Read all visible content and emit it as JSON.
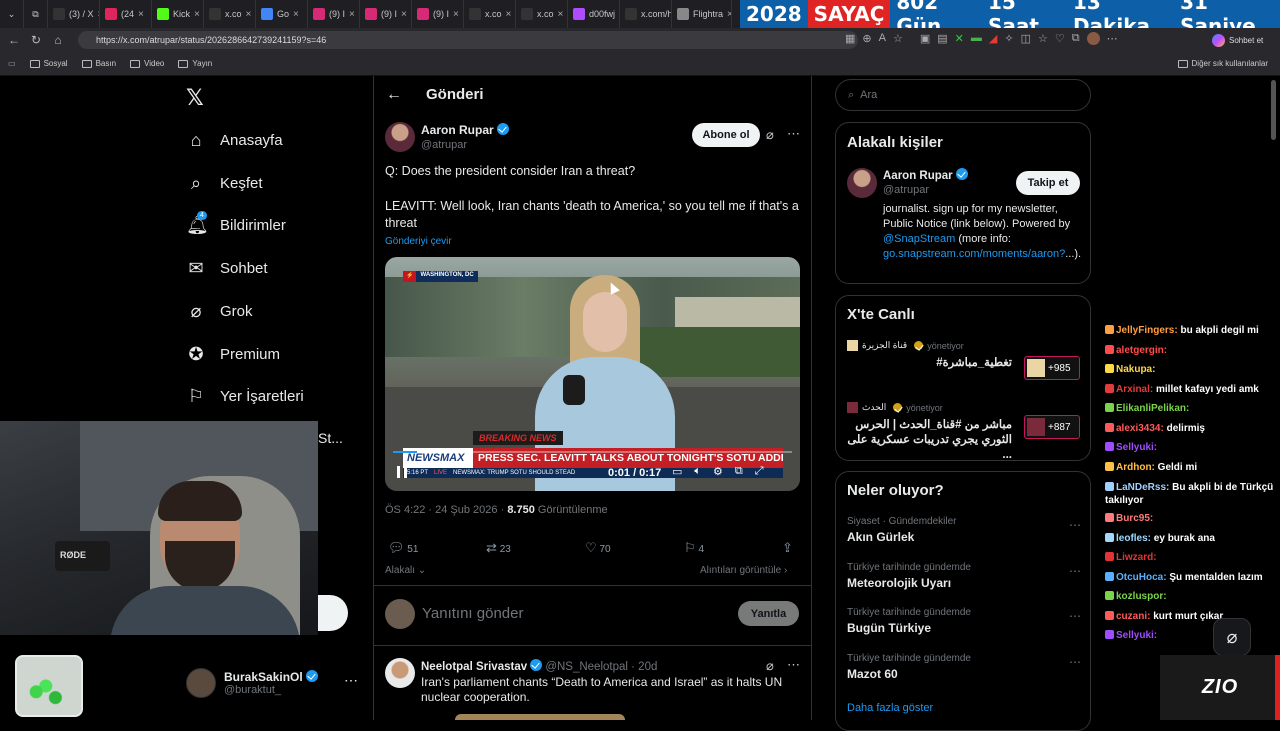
{
  "browser": {
    "tabs": [
      {
        "label": "(3) / X",
        "color": "#333"
      },
      {
        "label": "(24",
        "color": "#e0245e"
      },
      {
        "label": "Kick",
        "color": "#53fc18"
      },
      {
        "label": "x.co",
        "color": "#333"
      },
      {
        "label": "Go",
        "color": "#4285f4"
      },
      {
        "label": "(9) I",
        "color": "#d62976"
      },
      {
        "label": "(9) I",
        "color": "#d62976"
      },
      {
        "label": "(9) I",
        "color": "#d62976"
      },
      {
        "label": "x.co",
        "color": "#333"
      },
      {
        "label": "x.co",
        "color": "#333"
      },
      {
        "label": "d00fwj",
        "color": "#b04cff"
      },
      {
        "label": "x.com/h",
        "color": "#333"
      },
      {
        "label": "Flightra",
        "color": "#888"
      }
    ],
    "url": "https://x.com/atrupar/status/2026286642739241159?s=46",
    "chat_button": "Sohbet et",
    "bookmarks": [
      "Sosyal",
      "Basın",
      "Video",
      "Yayın"
    ],
    "other_bookmarks": "Diğer sık kullanılanlar"
  },
  "counter": {
    "year": "2028",
    "label": "SAYAÇ",
    "days": "802 Gün",
    "hours": "15 Saat",
    "minutes": "13 Dakika",
    "seconds": "31 Saniye"
  },
  "nav": {
    "items": [
      "Anasayfa",
      "Keşfet",
      "Bildirimler",
      "Sohbet",
      "Grok",
      "Premium",
      "Yer İşaretleri"
    ],
    "notif_count": "4",
    "partial_item": "St...",
    "user_name": "BurakSakinOl",
    "user_handle": "@buraktut_"
  },
  "post": {
    "header": "Gönderi",
    "author": "Aaron Rupar",
    "handle": "@atrupar",
    "subscribe": "Abone ol",
    "line1": "Q: Does the president consider Iran a threat?",
    "line2": "LEAVITT: Well look, Iran chants 'death to America,' so you tell me if that's a threat",
    "translate": "Gönderiyi çevir",
    "video": {
      "location": "WASHINGTON, DC",
      "breaking": "BREAKING NEWS",
      "network": "NEWSMAX",
      "headline": "PRESS SEC. LEAVITT TALKS ABOUT TONIGHT'S SOTU ADDRESS",
      "ticker": "NEWSMAX: TRUMP SOTU SHOULD STEAD",
      "time_left": "5:16 PT",
      "live": "LIVE",
      "timecode": "0:01 / 0:17",
      "progress": 0.06
    },
    "meta_time": "ÖS 4:22 · 24 Şub 2026 ·",
    "views": "8.750",
    "views_label": "Görüntülenme",
    "replies": "51",
    "reposts": "23",
    "likes": "70",
    "bookmarks": "4",
    "relevant": "Alakalı",
    "quotes": "Alıntıları görüntüle",
    "reply_placeholder": "Yanıtını gönder",
    "reply_button": "Yanıtla"
  },
  "reply": {
    "author": "Neelotpal Srivastav",
    "handle": "@NS_Neelotpal",
    "age": "· 20d",
    "text": "Iran's parliament chants “Death to America and Israel” as it halts UN nuclear cooperation."
  },
  "right": {
    "search_placeholder": "Ara",
    "people_title": "Alakalı kişiler",
    "person_name": "Aaron Rupar",
    "person_handle": "@atrupar",
    "follow": "Takip et",
    "bio1": "journalist. sign up for my newsletter, Public Notice (link below). Powered by",
    "bio_link1": "@SnapStream",
    "bio2": " (more info: ",
    "bio_link2": "go.snapstream.com/moments/aaron?",
    "bio3": "...).",
    "live_title": "X'te Canlı",
    "live": [
      {
        "host": "قناة الجزيرة",
        "role": "yönetiyor",
        "title": "تغطية_مباشرة#",
        "count": "+985"
      },
      {
        "host": "الحدث",
        "role": "yönetiyor",
        "title": "مباشر من #قناة_الحدث | الحرس الثوري يجري تدريبات عسكرية على ...",
        "count": "+887"
      }
    ],
    "trends_title": "Neler oluyor?",
    "trends": [
      {
        "cat": "Siyaset · Gündemdekiler",
        "name": "Akın Gürlek"
      },
      {
        "cat": "Türkiye tarihinde gündemde",
        "name": "Meteorolojik Uyarı"
      },
      {
        "cat": "Türkiye tarihinde gündemde",
        "name": "Bugün Türkiye"
      },
      {
        "cat": "Türkiye tarihinde gündemde",
        "name": "Mazot 60"
      }
    ],
    "show_more": "Daha fazla göster"
  },
  "chat": [
    {
      "user": "JellyFingers:",
      "msg": "bu akpli degil mi",
      "color": "#ff9f40"
    },
    {
      "user": "aletgergin:",
      "msg": "",
      "color": "#ff4b4b"
    },
    {
      "user": "Nakupa:",
      "msg": "",
      "color": "#ffd84a"
    },
    {
      "user": "Arxinal:",
      "msg": "millet kafayı yedi amk",
      "color": "#e03c3c"
    },
    {
      "user": "ElikanliPelikan:",
      "msg": "",
      "color": "#7bd34a"
    },
    {
      "user": "alexi3434:",
      "msg": "delirmiş",
      "color": "#ff5a5a"
    },
    {
      "user": "Sellyuki:",
      "msg": "",
      "color": "#a04cff"
    },
    {
      "user": "Ardhon:",
      "msg": "Geldi mi",
      "color": "#ffc04a"
    },
    {
      "user": "LaNDeRss:",
      "msg": "Bu akpli bi de Türkçü takılıyor",
      "color": "#9fd0ff"
    },
    {
      "user": "Burc95:",
      "msg": "",
      "color": "#ff7a7a"
    },
    {
      "user": "leofles:",
      "msg": "ey burak ana",
      "color": "#a0d8ff"
    },
    {
      "user": "Liwzard:",
      "msg": "",
      "color": "#e23434"
    },
    {
      "user": "OtcuHoca:",
      "msg": "Şu mentalden lazım",
      "color": "#5ab0ff"
    },
    {
      "user": "kozluspor:",
      "msg": "",
      "color": "#7bd34a"
    },
    {
      "user": "cuzani:",
      "msg": "kurt murt çıkar",
      "color": "#ff5a5a"
    },
    {
      "user": "Sellyuki:",
      "msg": "",
      "color": "#a04cff"
    }
  ],
  "stream_logo": "ZIO"
}
